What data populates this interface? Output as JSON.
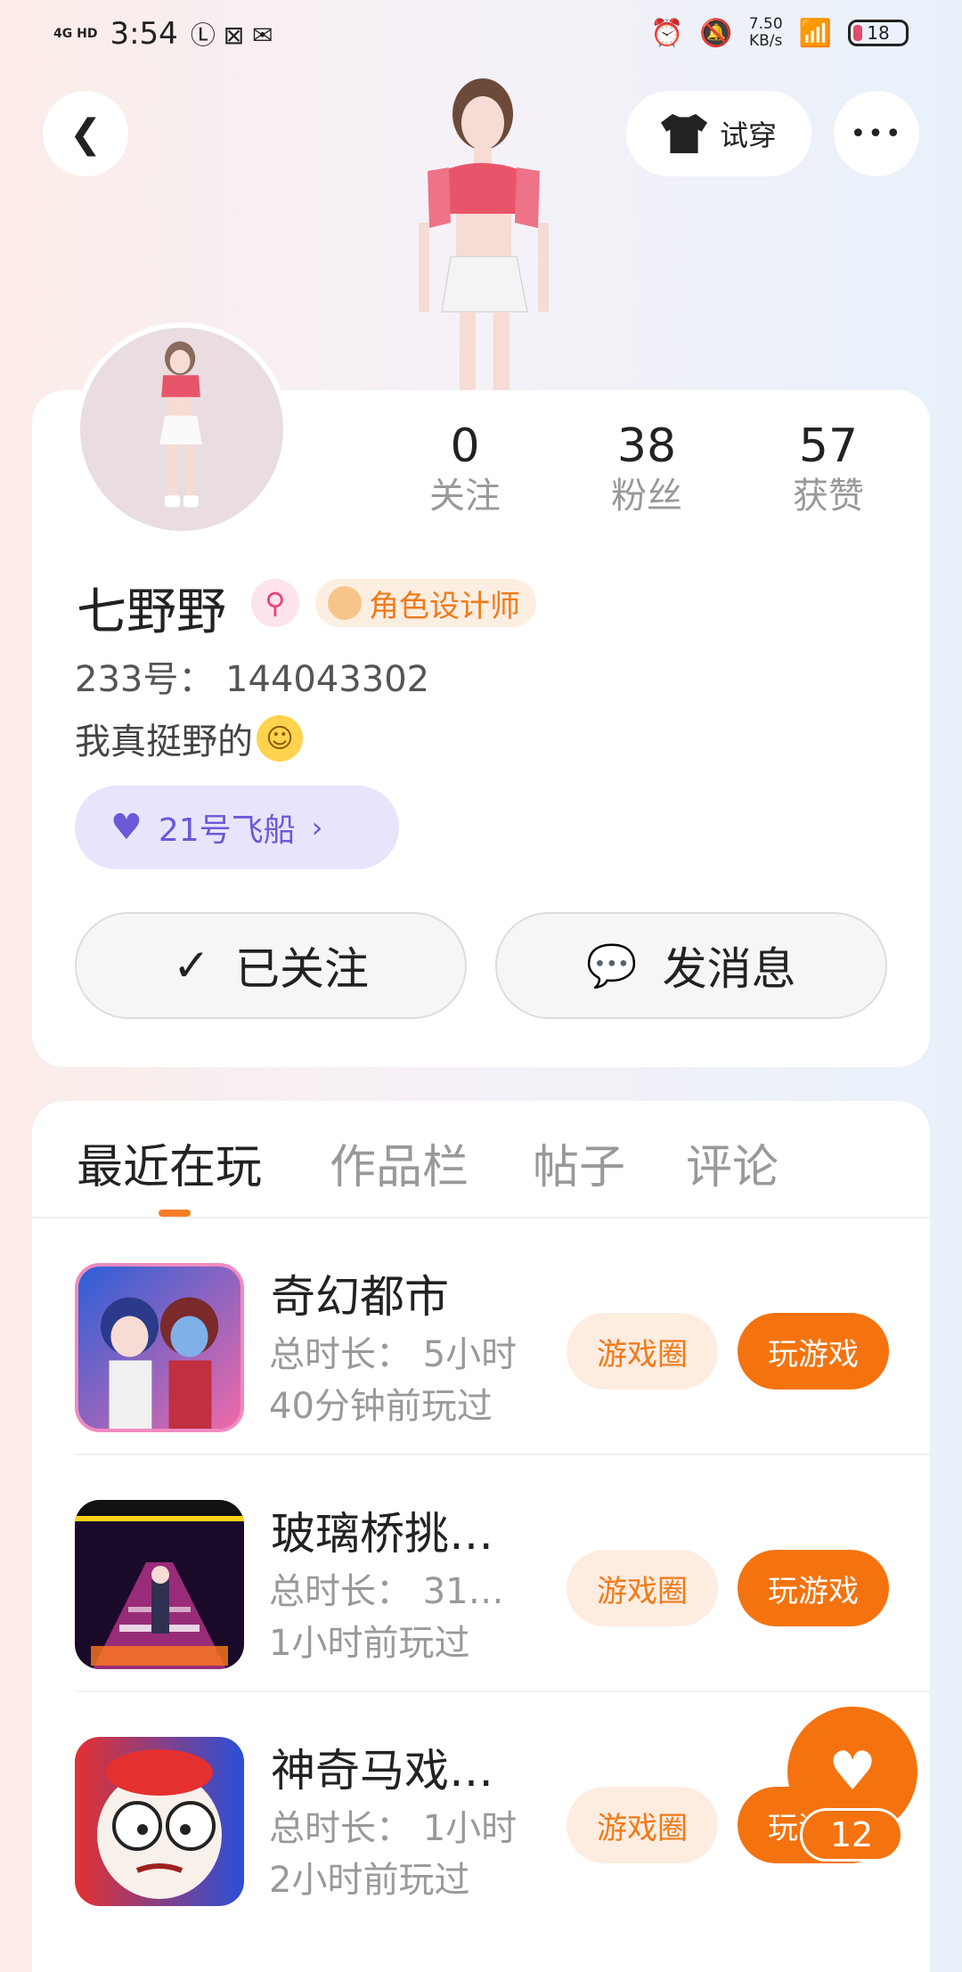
{
  "status_bar": {
    "signal": "4G HD",
    "time": "3:54",
    "speed_value": "7.50",
    "speed_unit": "KB/s",
    "battery": "18"
  },
  "header": {
    "tryon_label": "试穿",
    "more_label": "•••"
  },
  "profile": {
    "stats": [
      {
        "value": "0",
        "label": "关注"
      },
      {
        "value": "38",
        "label": "粉丝"
      },
      {
        "value": "57",
        "label": "获赞"
      }
    ],
    "name": "七野野",
    "role_badge": "角色设计师",
    "uid": "233号： 144043302",
    "bio": "我真挺野的",
    "ship_label": "21号飞船",
    "follow_label": "已关注",
    "message_label": "发消息"
  },
  "tabs": [
    "最近在玩",
    "作品栏",
    "帖子",
    "评论"
  ],
  "games": [
    {
      "title": "奇幻都市",
      "duration": "总时长： 5小时",
      "last_played": "40分钟前玩过",
      "circle_label": "游戏圈",
      "play_label": "玩游戏"
    },
    {
      "title": "玻璃桥挑…",
      "duration": "总时长： 31…",
      "last_played": "1小时前玩过",
      "circle_label": "游戏圈",
      "play_label": "玩游戏"
    },
    {
      "title": "神奇马戏…",
      "duration": "总时长： 1小时",
      "last_played": "2小时前玩过",
      "circle_label": "游戏圈",
      "play_label": "玩游戏"
    }
  ],
  "fab": {
    "count": "12"
  },
  "colors": {
    "accent": "#f4730f",
    "ship": "#6a5ad8",
    "badge": "#f07a1a"
  }
}
